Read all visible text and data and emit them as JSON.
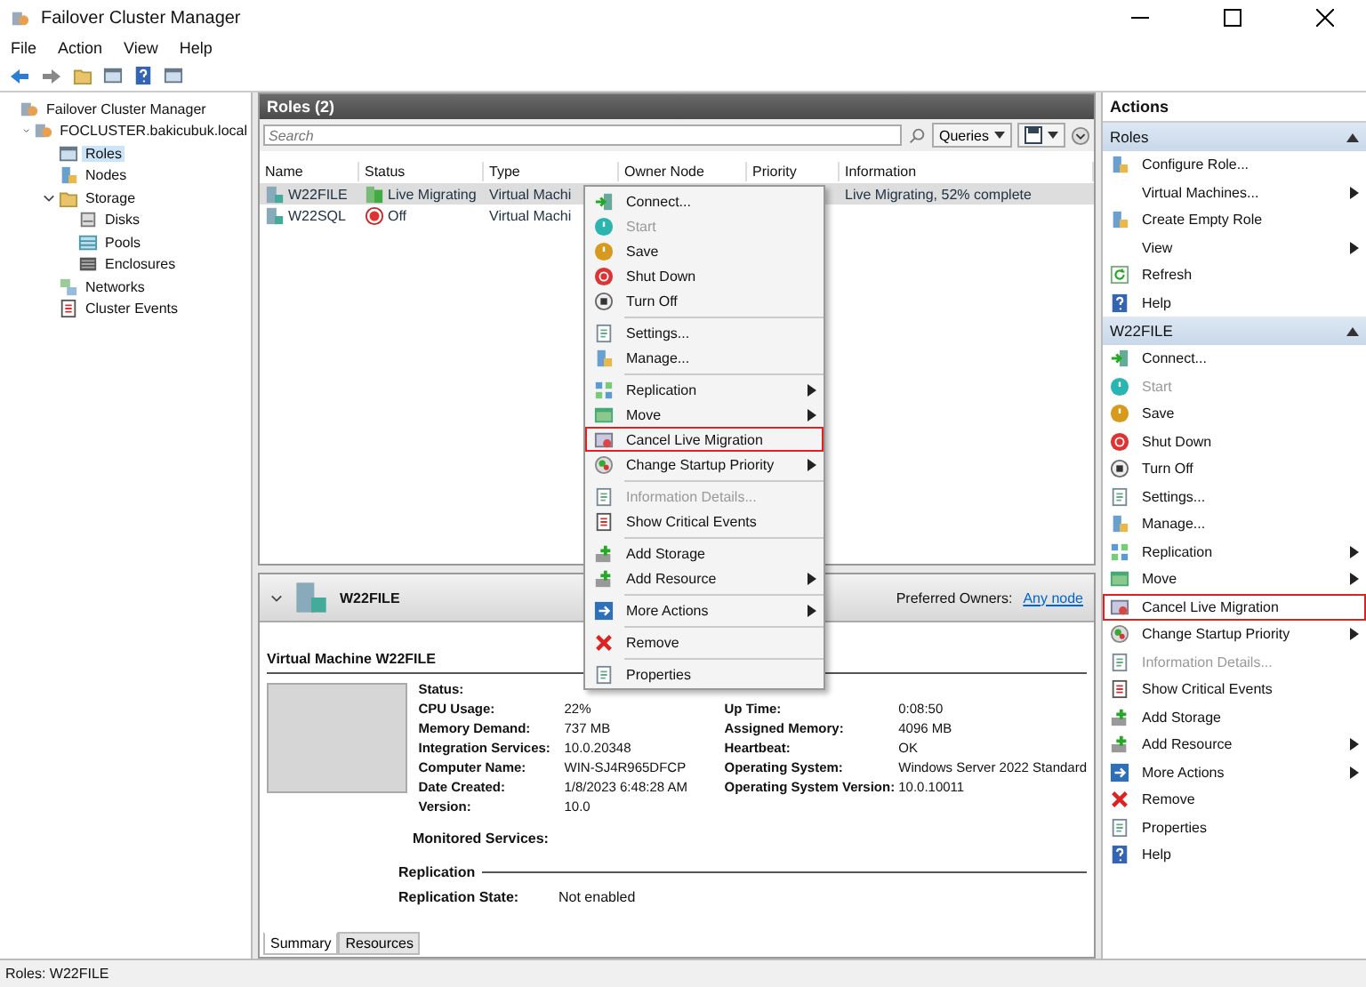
{
  "window": {
    "title": "Failover Cluster Manager"
  },
  "menubar": [
    "File",
    "Action",
    "View",
    "Help"
  ],
  "tree": [
    {
      "label": "Failover Cluster Manager",
      "selected": false,
      "children": [
        {
          "label": "FOCLUSTER.bakicubuk.local",
          "selected": false,
          "expanded": true,
          "children": [
            {
              "label": "Roles",
              "selected": true
            },
            {
              "label": "Nodes",
              "selected": false
            },
            {
              "label": "Storage",
              "selected": false,
              "expanded": true,
              "children": [
                {
                  "label": "Disks",
                  "selected": false
                },
                {
                  "label": "Pools",
                  "selected": false
                },
                {
                  "label": "Enclosures",
                  "selected": false
                }
              ]
            },
            {
              "label": "Networks",
              "selected": false
            },
            {
              "label": "Cluster Events",
              "selected": false
            }
          ]
        }
      ]
    }
  ],
  "roles": {
    "title": "Roles (2)",
    "search": {
      "placeholder": "Search"
    },
    "queries_button": "Queries",
    "columns": [
      "Name",
      "Status",
      "Type",
      "Owner Node",
      "Priority",
      "Information"
    ],
    "rows": [
      {
        "name": "W22FILE",
        "status": "Live Migrating",
        "kind": "migrating",
        "type": "Virtual Machi",
        "information": "Live Migrating, 52% complete",
        "selected": true
      },
      {
        "name": "W22SQL",
        "status": "Off",
        "kind": "off",
        "type": "Virtual Machi",
        "selected": false
      }
    ]
  },
  "context_menu": {
    "groups": [
      [
        {
          "label": "Connect...",
          "disabled": false,
          "submenu": false,
          "highlighted": false
        },
        {
          "label": "Start",
          "disabled": true,
          "submenu": false,
          "highlighted": false
        },
        {
          "label": "Save",
          "disabled": false,
          "submenu": false,
          "highlighted": false
        },
        {
          "label": "Shut Down",
          "disabled": false,
          "submenu": false,
          "highlighted": false
        },
        {
          "label": "Turn Off",
          "disabled": false,
          "submenu": false,
          "highlighted": false
        }
      ],
      [
        {
          "label": "Settings...",
          "disabled": false,
          "submenu": false,
          "highlighted": false
        },
        {
          "label": "Manage...",
          "disabled": false,
          "submenu": false,
          "highlighted": false
        }
      ],
      [
        {
          "label": "Replication",
          "disabled": false,
          "submenu": true,
          "highlighted": false
        },
        {
          "label": "Move",
          "disabled": false,
          "submenu": true,
          "highlighted": false
        },
        {
          "label": "Cancel Live Migration",
          "disabled": false,
          "submenu": false,
          "highlighted": true
        },
        {
          "label": "Change Startup Priority",
          "disabled": false,
          "submenu": true,
          "highlighted": false
        }
      ],
      [
        {
          "label": "Information Details...",
          "disabled": true,
          "submenu": false,
          "highlighted": false
        },
        {
          "label": "Show Critical Events",
          "disabled": false,
          "submenu": false,
          "highlighted": false
        }
      ],
      [
        {
          "label": "Add Storage",
          "disabled": false,
          "submenu": false,
          "highlighted": false
        },
        {
          "label": "Add Resource",
          "disabled": false,
          "submenu": true,
          "highlighted": false
        }
      ],
      [
        {
          "label": "More Actions",
          "disabled": false,
          "submenu": true,
          "highlighted": false
        }
      ],
      [
        {
          "label": "Remove",
          "disabled": false,
          "submenu": false,
          "highlighted": false
        }
      ],
      [
        {
          "label": "Properties",
          "disabled": false,
          "submenu": false,
          "highlighted": false
        }
      ]
    ]
  },
  "details": {
    "name": "W22FILE",
    "expanded": true,
    "preferred_owners_label": "Preferred Owners:",
    "preferred_owners_link": "Any node",
    "title": "Virtual Machine W22FILE",
    "properties": [
      {
        "label": "Status:"
      },
      {
        "label": "CPU Usage:",
        "value": "22%",
        "right_label": "Up Time:",
        "right_value": "0:08:50"
      },
      {
        "label": "Memory Demand:",
        "value": "737 MB",
        "right_label": "Assigned Memory:",
        "right_value": "4096 MB"
      },
      {
        "label": "Integration Services:",
        "value": "10.0.20348",
        "right_label": "Heartbeat:",
        "right_value": "OK"
      },
      {
        "label": "Computer Name:",
        "value": "WIN-SJ4R965DFCP",
        "right_label": "Operating System:",
        "right_value": "Windows Server 2022 Standard"
      },
      {
        "label": "Date Created:",
        "value": "1/8/2023 6:48:28 AM",
        "right_label": "Operating System Version:",
        "right_value": "10.0.10011"
      },
      {
        "label": "Version:",
        "value": "10.0"
      }
    ],
    "monitored_services_label": "Monitored Services:",
    "replication_heading": "Replication",
    "replication_state_label": "Replication State:",
    "replication_state_value": "Not enabled",
    "tabs": [
      {
        "label": "Summary",
        "selected": true
      },
      {
        "label": "Resources",
        "selected": false
      }
    ]
  },
  "actions": {
    "title": "Actions",
    "sections": [
      {
        "header": "Roles",
        "expanded": true,
        "items": [
          {
            "label": "Configure Role...",
            "disabled": false,
            "submenu": false,
            "highlighted": false
          },
          {
            "label": "Virtual Machines...",
            "disabled": false,
            "submenu": true,
            "highlighted": false
          },
          {
            "label": "Create Empty Role",
            "disabled": false,
            "submenu": false,
            "highlighted": false
          },
          {
            "label": "View",
            "disabled": false,
            "submenu": true,
            "highlighted": false
          },
          {
            "label": "Refresh",
            "disabled": false,
            "submenu": false,
            "highlighted": false
          },
          {
            "label": "Help",
            "disabled": false,
            "submenu": false,
            "highlighted": false
          }
        ]
      },
      {
        "header": "W22FILE",
        "expanded": true,
        "items": [
          {
            "label": "Connect...",
            "disabled": false,
            "submenu": false,
            "highlighted": false
          },
          {
            "label": "Start",
            "disabled": true,
            "submenu": false,
            "highlighted": false
          },
          {
            "label": "Save",
            "disabled": false,
            "submenu": false,
            "highlighted": false
          },
          {
            "label": "Shut Down",
            "disabled": false,
            "submenu": false,
            "highlighted": false
          },
          {
            "label": "Turn Off",
            "disabled": false,
            "submenu": false,
            "highlighted": false
          },
          {
            "label": "Settings...",
            "disabled": false,
            "submenu": false,
            "highlighted": false
          },
          {
            "label": "Manage...",
            "disabled": false,
            "submenu": false,
            "highlighted": false
          },
          {
            "label": "Replication",
            "disabled": false,
            "submenu": true,
            "highlighted": false
          },
          {
            "label": "Move",
            "disabled": false,
            "submenu": true,
            "highlighted": false
          },
          {
            "label": "Cancel Live Migration",
            "disabled": false,
            "submenu": false,
            "highlighted": true
          },
          {
            "label": "Change Startup Priority",
            "disabled": false,
            "submenu": true,
            "highlighted": false
          },
          {
            "label": "Information Details...",
            "disabled": true,
            "submenu": false,
            "highlighted": false
          },
          {
            "label": "Show Critical Events",
            "disabled": false,
            "submenu": false,
            "highlighted": false
          },
          {
            "label": "Add Storage",
            "disabled": false,
            "submenu": false,
            "highlighted": false
          },
          {
            "label": "Add Resource",
            "disabled": false,
            "submenu": true,
            "highlighted": false
          },
          {
            "label": "More Actions",
            "disabled": false,
            "submenu": true,
            "highlighted": false
          },
          {
            "label": "Remove",
            "disabled": false,
            "submenu": false,
            "highlighted": false
          },
          {
            "label": "Properties",
            "disabled": false,
            "submenu": false,
            "highlighted": false
          },
          {
            "label": "Help",
            "disabled": false,
            "submenu": false,
            "highlighted": false
          }
        ]
      }
    ]
  },
  "status_bar": "Roles:  W22FILE"
}
